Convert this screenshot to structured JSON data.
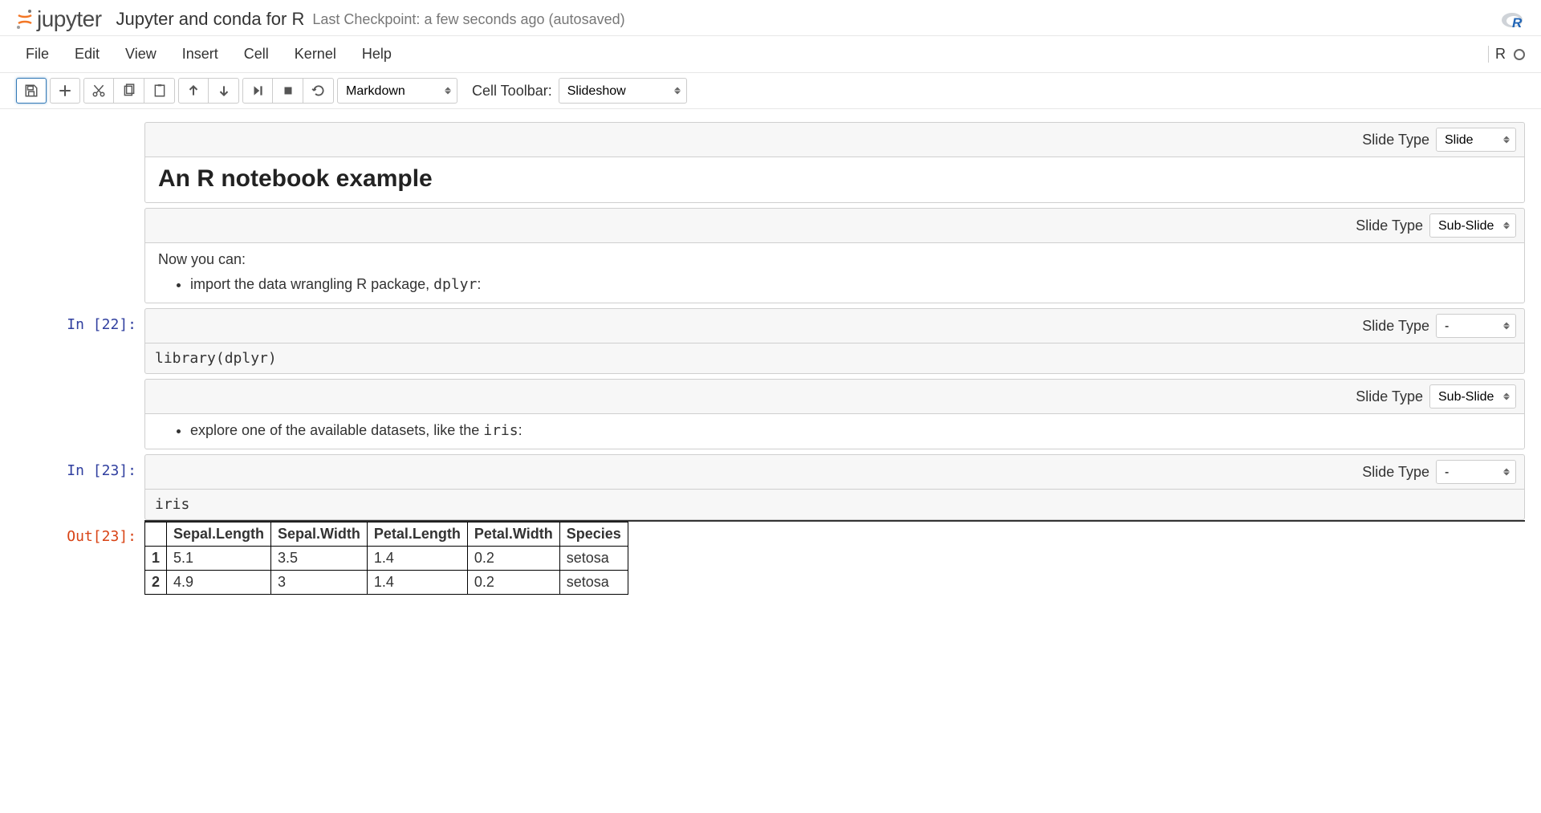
{
  "logo_text": "jupyter",
  "notebook_name": "Jupyter and conda for R",
  "checkpoint_text": "Last Checkpoint: a few seconds ago (autosaved)",
  "menu": {
    "file": "File",
    "edit": "Edit",
    "view": "View",
    "insert": "Insert",
    "cell": "Cell",
    "kernel": "Kernel",
    "help": "Help"
  },
  "kernel_indicator": "R",
  "cell_type_select": "Markdown",
  "cell_toolbar_label": "Cell Toolbar:",
  "cell_toolbar_select": "Slideshow",
  "slide_type_label": "Slide Type",
  "cells": {
    "c0": {
      "slide": "Slide",
      "heading": "An R notebook example"
    },
    "c1": {
      "slide": "Sub-Slide",
      "text": "Now you can:",
      "bullet_prefix": "import the data wrangling R package, ",
      "bullet_code": "dplyr",
      "bullet_suffix": ":"
    },
    "c2": {
      "prompt": "In [22]:",
      "slide": "-",
      "code": "library(dplyr)"
    },
    "c3": {
      "slide": "Sub-Slide",
      "bullet_prefix": "explore one of the available datasets, like the ",
      "bullet_code": "iris",
      "bullet_suffix": ":"
    },
    "c4": {
      "prompt": "In [23]:",
      "slide": "-",
      "code": "iris",
      "out_prompt": "Out[23]:"
    }
  },
  "table": {
    "headers": [
      "",
      "Sepal.Length",
      "Sepal.Width",
      "Petal.Length",
      "Petal.Width",
      "Species"
    ],
    "rows": [
      [
        "1",
        "5.1",
        "3.5",
        "1.4",
        "0.2",
        "setosa"
      ],
      [
        "2",
        "4.9",
        "3",
        "1.4",
        "0.2",
        "setosa"
      ]
    ]
  }
}
